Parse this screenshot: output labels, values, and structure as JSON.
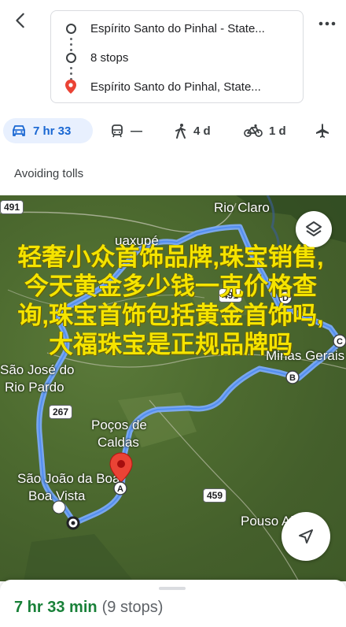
{
  "header": {
    "back_icon": "arrow-left-icon",
    "more_icon": "more-horiz-icon",
    "origin": "Espírito Santo do Pinhal - State...",
    "stops": "8 stops",
    "destination": "Espírito Santo do Pinhal, State..."
  },
  "modes": {
    "drive": {
      "icon": "car-icon",
      "label": "7 hr 33",
      "active": true
    },
    "transit": {
      "icon": "train-icon",
      "label": "—"
    },
    "walk": {
      "icon": "walk-icon",
      "label": "4 d"
    },
    "bike": {
      "icon": "bike-icon",
      "label": "1 d"
    },
    "flight": {
      "icon": "airplane-icon",
      "label": ""
    }
  },
  "avoiding": "Avoiding tolls",
  "map": {
    "route_color": "#7baaf7",
    "labels": {
      "rio_claro": "Rio Claro",
      "guaxupe": "uaxupé",
      "jose_line1": "São José do",
      "jose_line2": "Rio Pardo",
      "pocos_line1": "Poços de",
      "pocos_line2": "Caldas",
      "joao_line1": "São João da Boa",
      "joao_line2": "Boa Vista",
      "minas": "Minas Gerais",
      "pouso": "Pouso Alegre"
    },
    "shields": [
      "491",
      "491",
      "267",
      "459"
    ],
    "stop_letters": [
      "A",
      "B",
      "C",
      "D"
    ],
    "layers_icon": "layers-icon",
    "locate_icon": "navigation-arrow-icon",
    "overlay_text": "轻奢小众首饰品牌,珠宝销售,今天黄金多少钱一克价格查询,珠宝首饰包括黄金首饰吗,大福珠宝是正规品牌吗"
  },
  "summary": {
    "duration": "7 hr 33 min",
    "stops": "(9 stops)"
  },
  "colors": {
    "accent": "#1a73e8",
    "active_tab_bg": "#e8f0fe",
    "duration_green": "#188038",
    "pin_red": "#ea4335"
  }
}
